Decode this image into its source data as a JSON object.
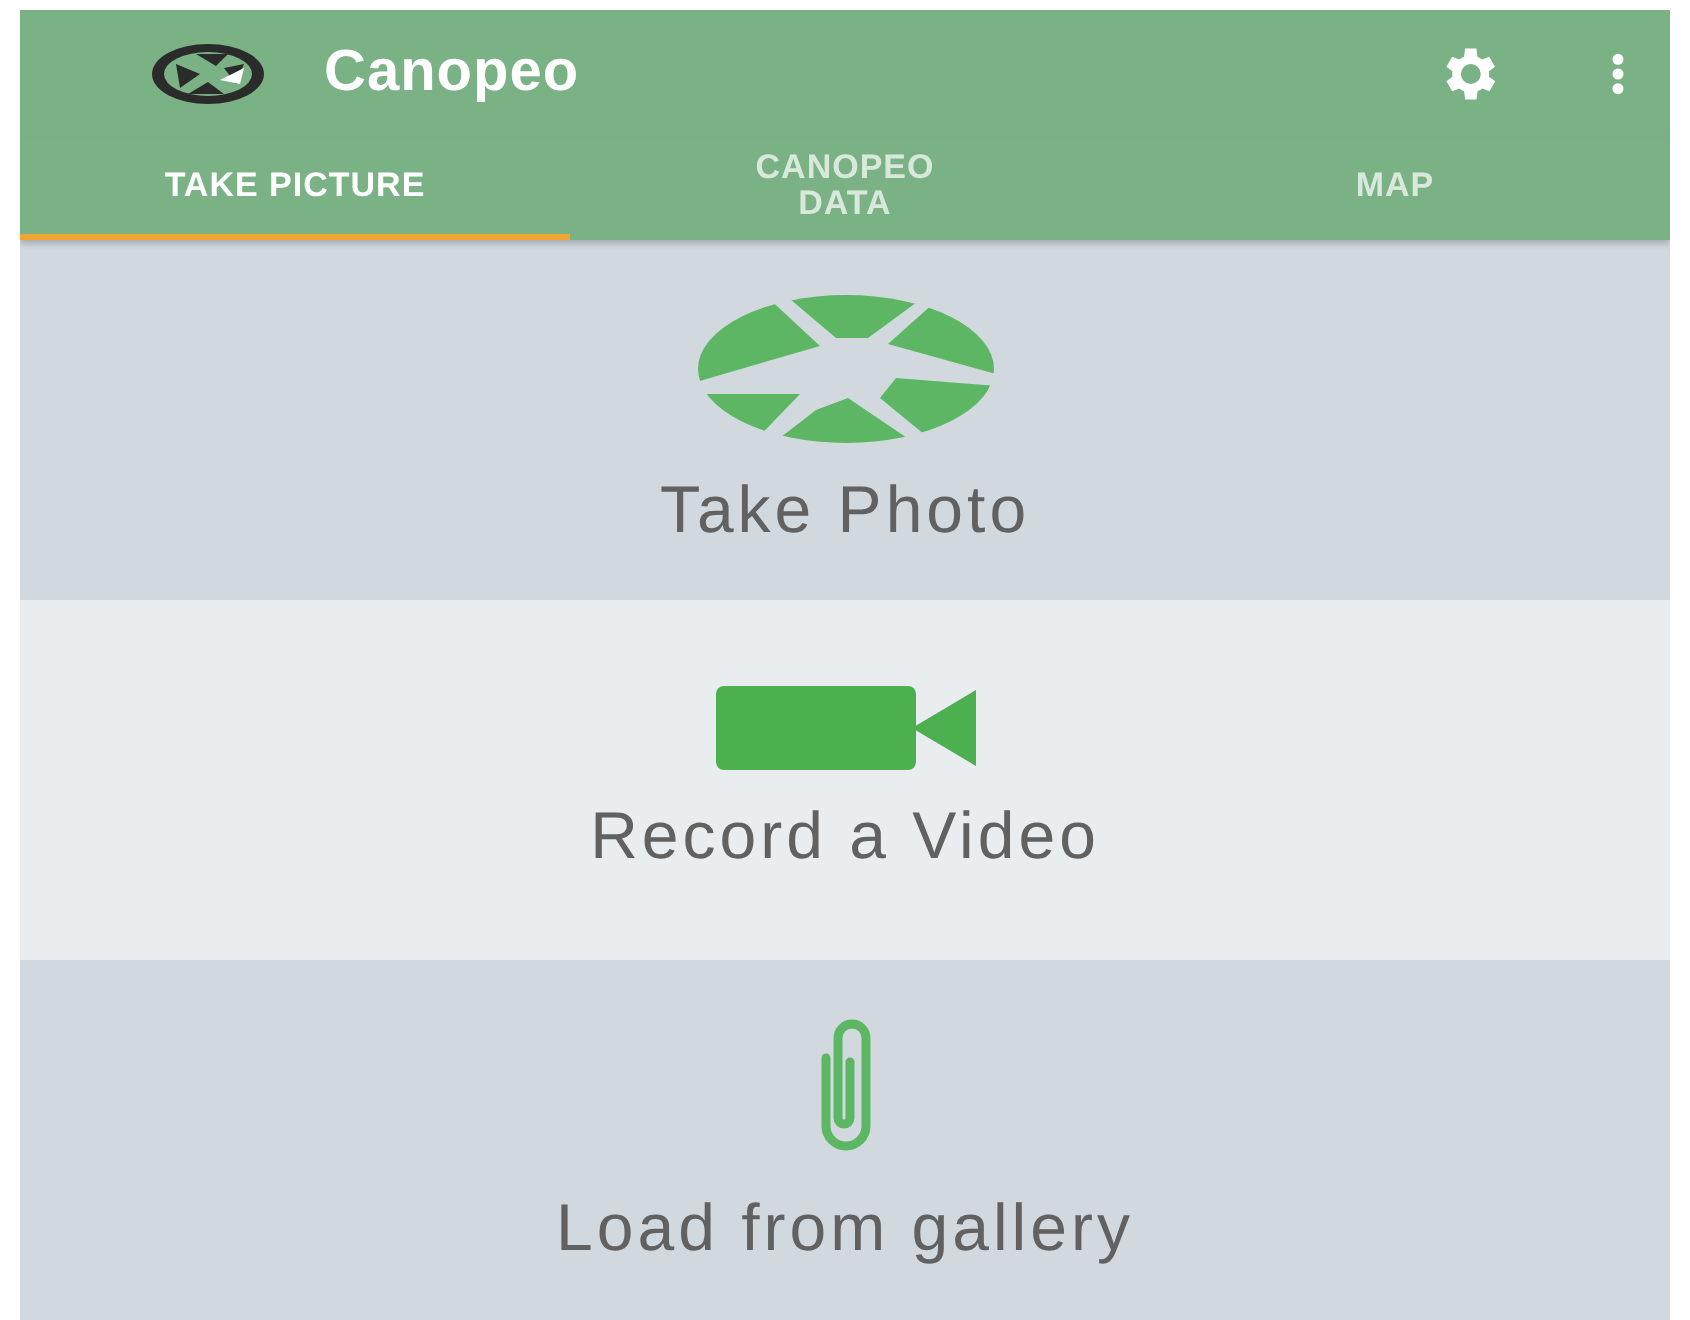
{
  "app_bar": {
    "title": "Canopeo"
  },
  "tabs": [
    {
      "label": "TAKE PICTURE",
      "selected": true
    },
    {
      "label": "CANOPEO\nDATA",
      "selected": false
    },
    {
      "label": "MAP",
      "selected": false
    }
  ],
  "actions": [
    {
      "kind": "photo",
      "label": "Take Photo"
    },
    {
      "kind": "video",
      "label": "Record a Video"
    },
    {
      "kind": "gallery",
      "label": "Load from gallery"
    }
  ]
}
